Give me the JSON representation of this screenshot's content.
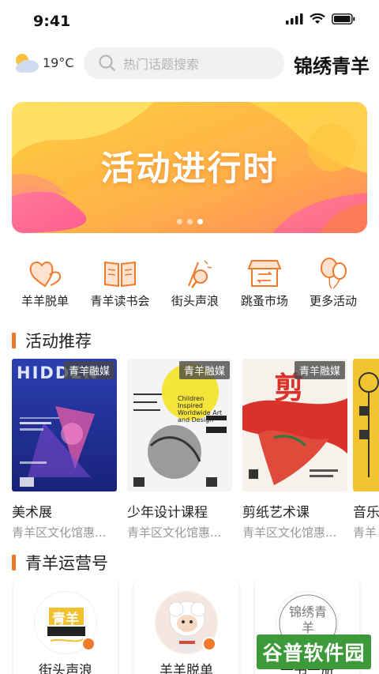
{
  "status_bar": {
    "time": "9:41"
  },
  "header": {
    "weather_icon": "partly-cloudy-icon",
    "temperature": "19°C",
    "search_placeholder": "热门话题搜索",
    "brand": "锦绣青羊"
  },
  "banner": {
    "title": "活动进行时",
    "dots": 3,
    "active_dot": 2
  },
  "quick_nav": [
    {
      "label": "羊羊脱单",
      "icon": "hearts-icon"
    },
    {
      "label": "青羊读书会",
      "icon": "book-icon"
    },
    {
      "label": "街头声浪",
      "icon": "microphone-icon"
    },
    {
      "label": "跳蚤市场",
      "icon": "market-icon"
    },
    {
      "label": "更多活动",
      "icon": "balloons-icon"
    }
  ],
  "sections": {
    "activities_title": "活动推荐",
    "operators_title": "青羊运营号"
  },
  "activities": [
    {
      "tag": "青羊融媒",
      "title": "美术展",
      "subtitle": "青羊区文化馆惠...",
      "poster_text": "HIDDEN"
    },
    {
      "tag": "青羊融媒",
      "title": "少年设计课程",
      "subtitle": "青羊区文化馆惠...",
      "poster_text": "Children Inspired Worldwide Art and Design"
    },
    {
      "tag": "青羊融媒",
      "title": "剪纸艺术课",
      "subtitle": "青羊区文化馆惠...",
      "poster_text": "剪"
    },
    {
      "tag": "",
      "title": "音乐",
      "subtitle": "青羊",
      "poster_text": ""
    }
  ],
  "operators": [
    {
      "name": "街头声浪",
      "avatar_text": "青羊"
    },
    {
      "name": "羊羊脱单",
      "avatar_text": ""
    },
    {
      "name": "一书一册",
      "avatar_text": "锦绣青羊"
    }
  ],
  "watermark": "谷普软件园",
  "colors": {
    "accent": "#f07a2c",
    "tag_bg": "#4a4a4a",
    "search_bg": "#f1f1f1"
  }
}
